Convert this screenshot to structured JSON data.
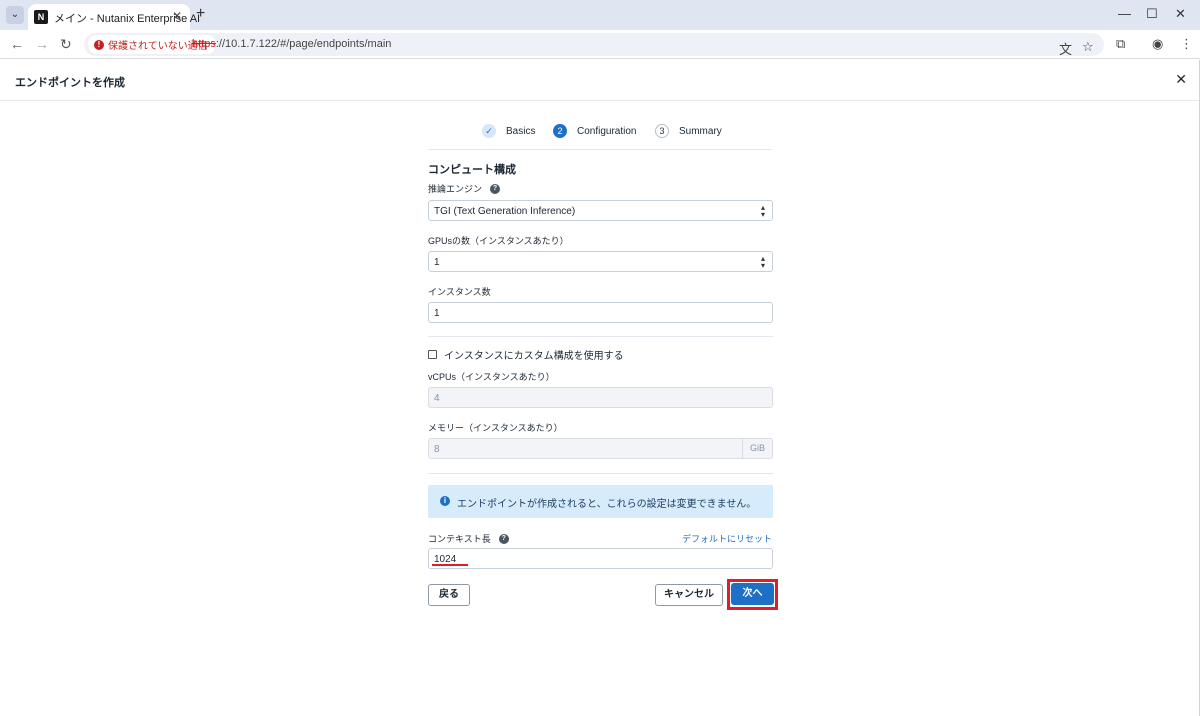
{
  "browser": {
    "tab_title": "メイン - Nutanix Enterprise AI",
    "tab_favicon_text": "N",
    "security_label": "保護されていない通信",
    "url_scheme": "https",
    "url_rest": "://10.1.7.122/#/page/endpoints/main"
  },
  "header": {
    "title": "エンドポイントを作成"
  },
  "stepper": {
    "steps": [
      {
        "label": "Basics",
        "marker": "✓",
        "state": "done"
      },
      {
        "label": "Configuration",
        "marker": "2",
        "state": "active"
      },
      {
        "label": "Summary",
        "marker": "3",
        "state": "todo"
      }
    ]
  },
  "form": {
    "section_title": "コンピュート構成",
    "engine": {
      "label": "推論エンジン",
      "value": "TGI (Text Generation Inference)"
    },
    "gpus": {
      "label": "GPUsの数（インスタンスあたり）",
      "value": "1"
    },
    "instances": {
      "label": "インスタンス数",
      "value": "1"
    },
    "custom_config": {
      "label": "インスタンスにカスタム構成を使用する",
      "checked": false
    },
    "vcpus": {
      "label": "vCPUs（インスタンスあたり）",
      "value": "4"
    },
    "memory": {
      "label": "メモリー（インスタンスあたり）",
      "value": "8",
      "unit": "GiB"
    },
    "info_message": "エンドポイントが作成されると、これらの設定は変更できません。",
    "context_length": {
      "label": "コンテキスト長",
      "value": "1024",
      "reset_label": "デフォルトにリセット"
    }
  },
  "footer": {
    "back_label": "戻る",
    "cancel_label": "キャンセル",
    "next_label": "次へ"
  },
  "colors": {
    "primary": "#1e6fc6",
    "highlight": "#e01e2b",
    "info_bg": "#d6ebfb"
  }
}
